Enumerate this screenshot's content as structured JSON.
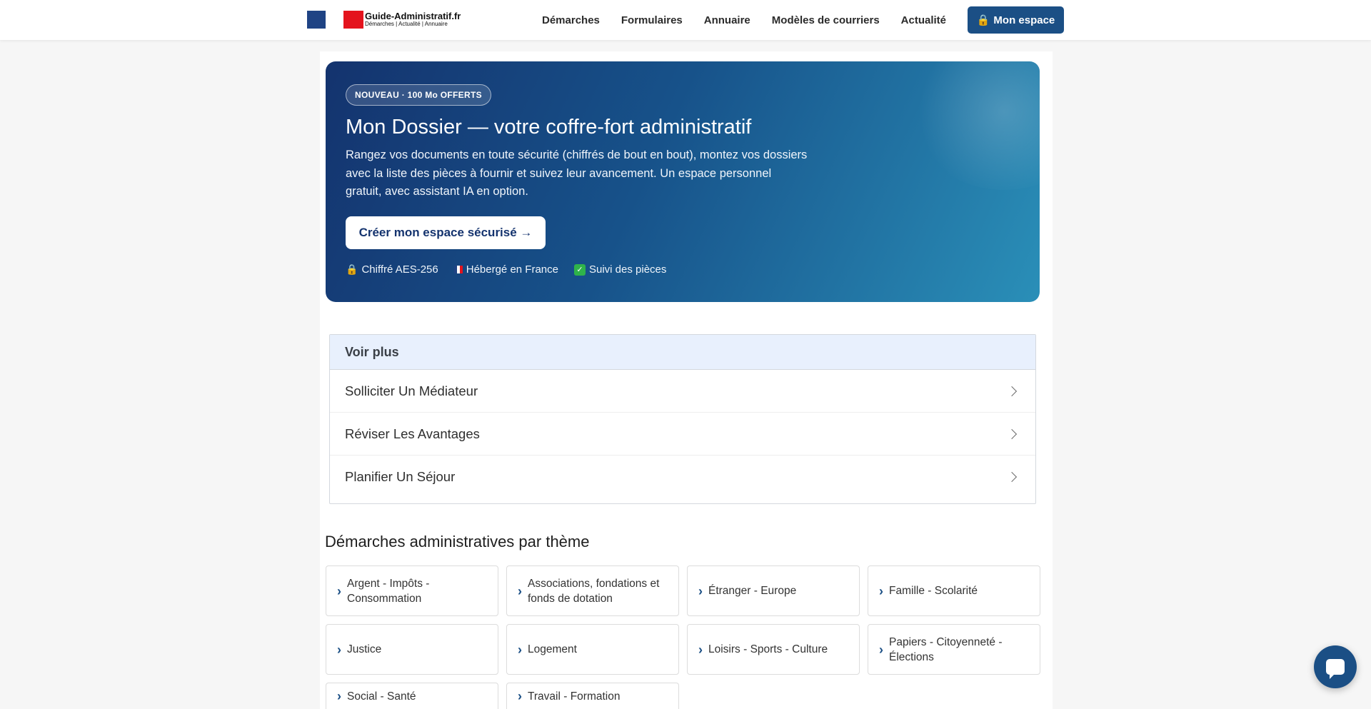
{
  "header": {
    "logo_title": "Guide-Administratif.fr",
    "logo_subtitle": "Démarches | Actualité | Annuaire",
    "nav": [
      "Démarches",
      "Formulaires",
      "Annuaire",
      "Modèles de courriers",
      "Actualité"
    ],
    "account_button": "Mon espace",
    "account_icon": "lock-icon"
  },
  "hero": {
    "badge": "NOUVEAU · 100 Mo OFFERTS",
    "title": "Mon Dossier — votre coffre-fort administratif",
    "description": "Rangez vos documents en toute sécurité (chiffrés de bout en bout), montez vos dossiers avec la liste des pièces à fournir et suivez leur avancement. Un espace personnel gratuit, avec assistant IA en option.",
    "cta": "Créer mon espace sécurisé →",
    "features": [
      "Chiffré AES-256",
      "Hébergé en France",
      "Suivi des pièces"
    ],
    "feature_icons": [
      "lock-icon",
      "french-flag-icon",
      "check-icon"
    ]
  },
  "voir_plus": {
    "title": "Voir plus",
    "items": [
      "Solliciter Un Médiateur",
      "Réviser Les Avantages",
      "Planifier Un Séjour"
    ]
  },
  "themes": {
    "title": "Démarches administratives par thème",
    "items": [
      "Argent - Impôts - Consommation",
      "Associations, fondations et fonds de dotation",
      "Étranger - Europe",
      "Famille - Scolarité",
      "Justice",
      "Logement",
      "Loisirs - Sports - Culture",
      "Papiers - Citoyenneté - Élections",
      "Social - Santé",
      "Travail - Formation"
    ]
  },
  "colors": {
    "brand_blue": "#1b4f85",
    "flag_blue": "#1f4384",
    "flag_red": "#e4131d",
    "voir_plus_header": "#e8f0fd"
  },
  "chat": {
    "icon": "chat-bubble-icon"
  }
}
